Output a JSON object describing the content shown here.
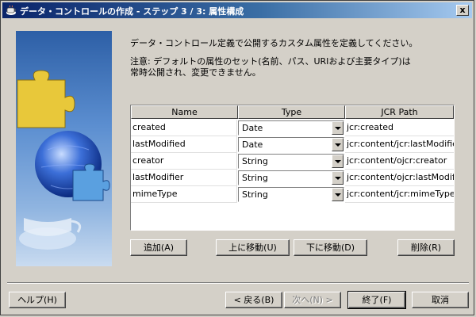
{
  "window": {
    "title": "データ・コントロールの作成 - ステップ 3 / 3: 属性構成",
    "close_label": "x"
  },
  "intro_text": "データ・コントロール定義で公開するカスタム属性を定義してください。",
  "note_lines": [
    "注意: デフォルトの属性のセット(名前、パス、URIおよび主要タイプ)は",
    "常時公開され、変更できません。"
  ],
  "table": {
    "columns": [
      "Name",
      "Type",
      "JCR Path"
    ],
    "rows": [
      {
        "name": "created",
        "type": "Date",
        "path": "jcr:created"
      },
      {
        "name": "lastModified",
        "type": "Date",
        "path": "jcr:content/jcr:lastModified"
      },
      {
        "name": "creator",
        "type": "String",
        "path": "jcr:content/ojcr:creator"
      },
      {
        "name": "lastModifier",
        "type": "String",
        "path": "jcr:content/ojcr:lastModifier"
      },
      {
        "name": "mimeType",
        "type": "String",
        "path": "jcr:content/jcr:mimeType"
      }
    ]
  },
  "table_buttons": {
    "add": "追加(A)",
    "move_up": "上に移動(U)",
    "move_down": "下に移動(D)",
    "delete": "削除(R)"
  },
  "footer_buttons": {
    "help": "ヘルプ(H)",
    "back": "< 戻る(B)",
    "next": "次へ(N) >",
    "finish": "終了(F)",
    "cancel": "取消"
  },
  "colors": {
    "titlebar_start": "#0a246a",
    "titlebar_end": "#a6caf0",
    "face": "#d4d0c8"
  }
}
